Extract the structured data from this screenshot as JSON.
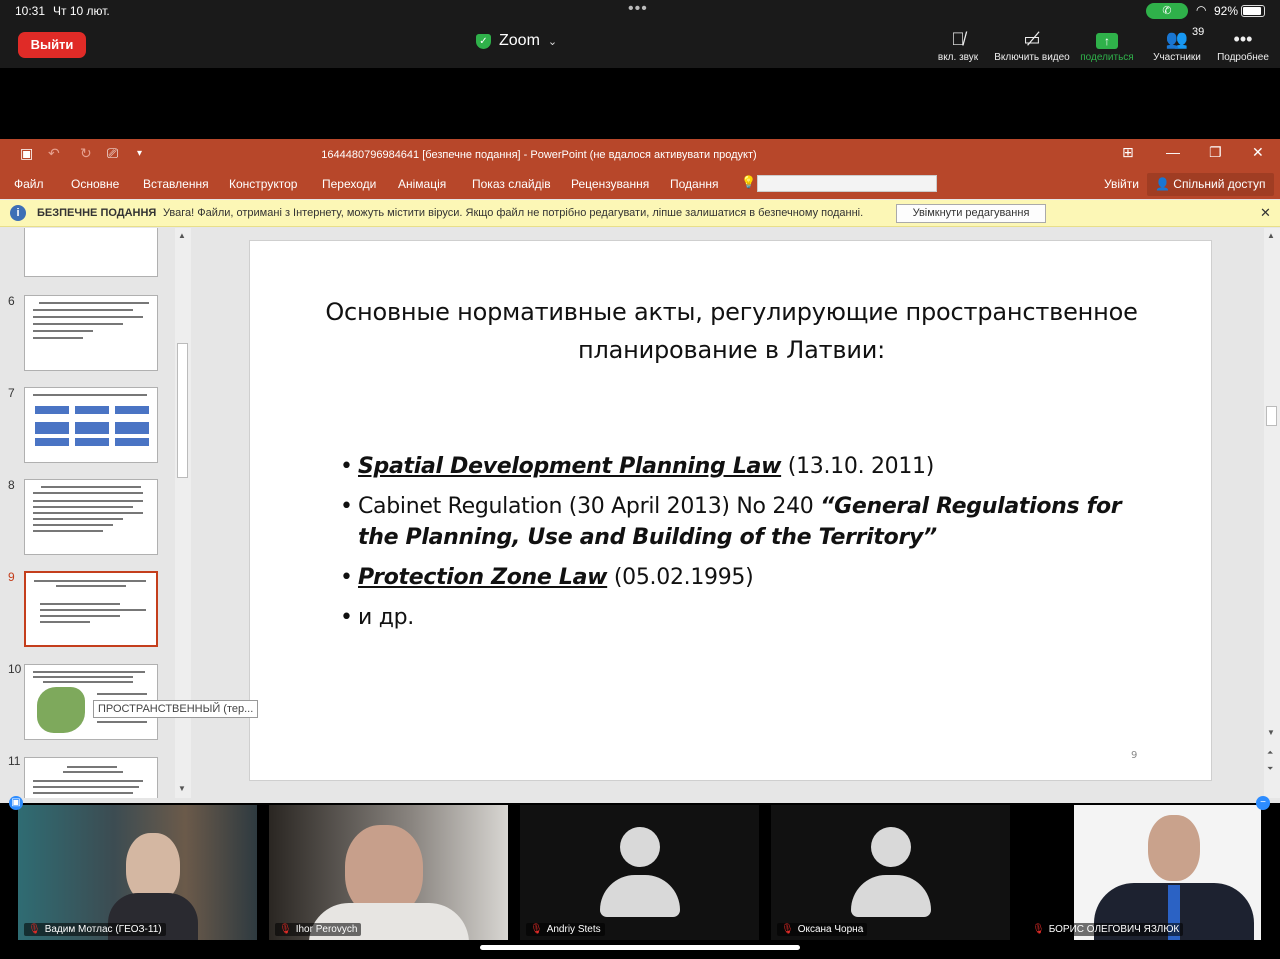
{
  "status": {
    "time": "10:31",
    "date": "Чт 10 лют.",
    "battery": "92%",
    "battery_level": 0.92
  },
  "zoom": {
    "leave_label": "Выйти",
    "app_title": "Zoom",
    "controls": {
      "audio": "вкл. звук",
      "video": "Включить видео",
      "share": "поделиться",
      "participants": "Участники",
      "more": "Подробнее"
    },
    "participant_count": "39"
  },
  "ppt": {
    "window_title": "1644480796984641 [безпечне подання] - PowerPoint (не вдалося активувати продукт)",
    "tabs": [
      "Файл",
      "Основне",
      "Вставлення",
      "Конструктор",
      "Переходи",
      "Анімація",
      "Показ слайдів",
      "Рецензування",
      "Подання"
    ],
    "signin": "Увійти",
    "share": "Спільний доступ",
    "infobar": {
      "label": "БЕЗПЕЧНЕ ПОДАННЯ",
      "message": "Увага! Файли, отримані з Інтернету, можуть містити віруси. Якщо файл не потрібно редагувати, ліпше залишатися в безпечному поданні.",
      "enable_button": "Увімкнути редагування"
    },
    "thumbnails": [
      {
        "num": "6",
        "selected": false
      },
      {
        "num": "7",
        "selected": false
      },
      {
        "num": "8",
        "selected": false
      },
      {
        "num": "9",
        "selected": true
      },
      {
        "num": "10",
        "selected": false
      },
      {
        "num": "11",
        "selected": false
      }
    ],
    "tooltip": "ПРОСТРАНСТВЕННЫЙ (тер...",
    "slide": {
      "title": "Основные нормативные акты, регулирующие пространственное планирование в Латвии:",
      "b1_em": "Spatial Development Planning Law",
      "b1_rest": " (13.10. 2011)",
      "b2_plain": "Cabinet Regulation (30 April 2013) No 240 ",
      "b2_em": "“General Regulations for the Planning, Use and Building of the Territory”",
      "b3_em": "Protection Zone Law",
      "b3_rest": " (05.02.1995)",
      "b4": "и др.",
      "page_number": "9"
    }
  },
  "participants": [
    {
      "name": "Вадим Мотлас (ГЕОЗ-11)",
      "video": true
    },
    {
      "name": "Ihor Perovych",
      "video": true
    },
    {
      "name": "Andriy Stets",
      "video": false
    },
    {
      "name": "Оксана Чорна",
      "video": false
    },
    {
      "name": "БОРИС ОЛЕГОВИЧ ЯЗЛЮК",
      "video": true
    }
  ],
  "colors": {
    "ppt_accent": "#b7472a",
    "zoom_red": "#e02b27",
    "zoom_green": "#2fb14a",
    "selection": "#c43e1c"
  }
}
